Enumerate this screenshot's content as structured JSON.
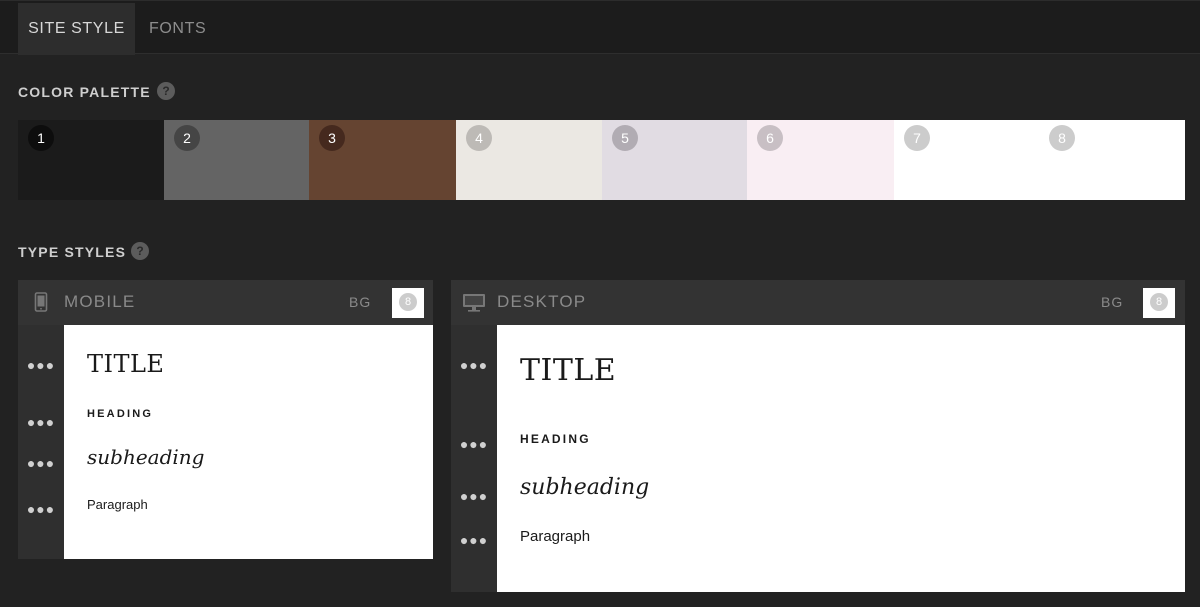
{
  "tabs": [
    {
      "label": "SITE STYLE",
      "active": true
    },
    {
      "label": "FONTS",
      "active": false
    }
  ],
  "color_palette": {
    "title": "COLOR PALETTE",
    "help": "?",
    "swatches": [
      {
        "number": "1",
        "color": "#1b1b1b"
      },
      {
        "number": "2",
        "color": "#646464"
      },
      {
        "number": "3",
        "color": "#654431"
      },
      {
        "number": "4",
        "color": "#ebe8e3"
      },
      {
        "number": "5",
        "color": "#e1dce3"
      },
      {
        "number": "6",
        "color": "#f9eef3"
      },
      {
        "number": "7",
        "color": "#ffffff"
      },
      {
        "number": "8",
        "color": "#ffffff"
      }
    ]
  },
  "type_styles": {
    "title": "TYPE STYLES",
    "help": "?",
    "mobile": {
      "label": "MOBILE",
      "bg_label": "BG",
      "bg_value": "8",
      "title": "TITLE",
      "heading": "HEADING",
      "subheading": "subheading",
      "paragraph": "Paragraph"
    },
    "desktop": {
      "label": "DESKTOP",
      "bg_label": "BG",
      "bg_value": "8",
      "title": "TITLE",
      "heading": "HEADING",
      "subheading": "subheading",
      "paragraph": "Paragraph"
    }
  },
  "icons": {
    "more": "more-horizontal-icon",
    "mobile": "mobile-phone-icon",
    "desktop": "desktop-monitor-icon"
  },
  "colors": {
    "background": "#222222",
    "panel_header": "#333333",
    "tab_active": "#2d2d2d"
  }
}
